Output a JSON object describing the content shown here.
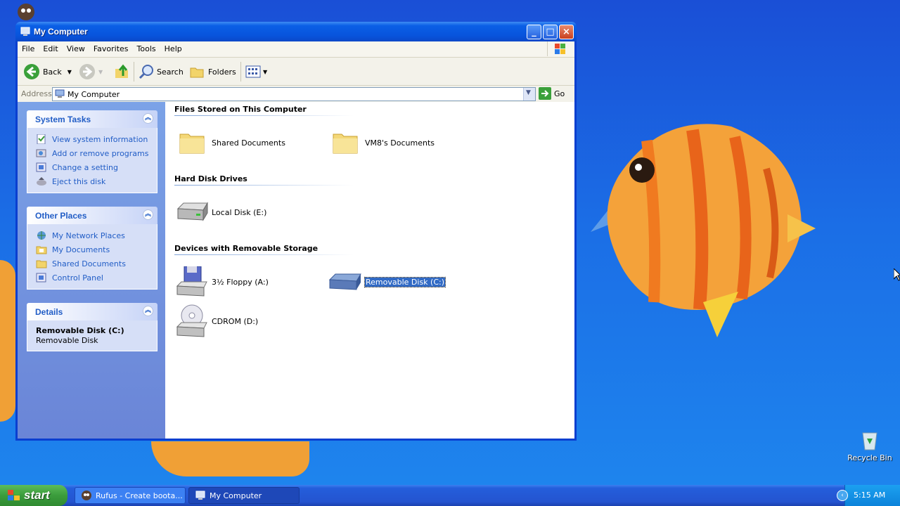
{
  "window": {
    "title": "My Computer"
  },
  "menu": [
    "File",
    "Edit",
    "View",
    "Favorites",
    "Tools",
    "Help"
  ],
  "toolbar": {
    "back": "Back",
    "search": "Search",
    "folders": "Folders"
  },
  "address": {
    "label": "Address",
    "value": "My Computer",
    "go": "Go"
  },
  "left_panels": {
    "system_tasks": {
      "title": "System Tasks",
      "items": [
        "View system information",
        "Add or remove programs",
        "Change a setting",
        "Eject this disk"
      ]
    },
    "other_places": {
      "title": "Other Places",
      "items": [
        "My Network Places",
        "My Documents",
        "Shared Documents",
        "Control Panel"
      ]
    },
    "details": {
      "title": "Details",
      "name": "Removable Disk (C:)",
      "type": "Removable Disk"
    }
  },
  "groups": {
    "files": {
      "title": "Files Stored on This Computer",
      "items": [
        "Shared Documents",
        "VM8's Documents"
      ]
    },
    "hdd": {
      "title": "Hard Disk Drives",
      "items": [
        "Local Disk (E:)"
      ]
    },
    "removable": {
      "title": "Devices with Removable Storage",
      "items": [
        "3½ Floppy (A:)",
        "Removable Disk (C:)",
        "CDROM (D:)"
      ]
    }
  },
  "desktop": {
    "recycle_bin": "Recycle Bin"
  },
  "taskbar": {
    "start": "start",
    "tasks": [
      "Rufus - Create boota...",
      "My Computer"
    ],
    "clock": "5:15 AM"
  }
}
